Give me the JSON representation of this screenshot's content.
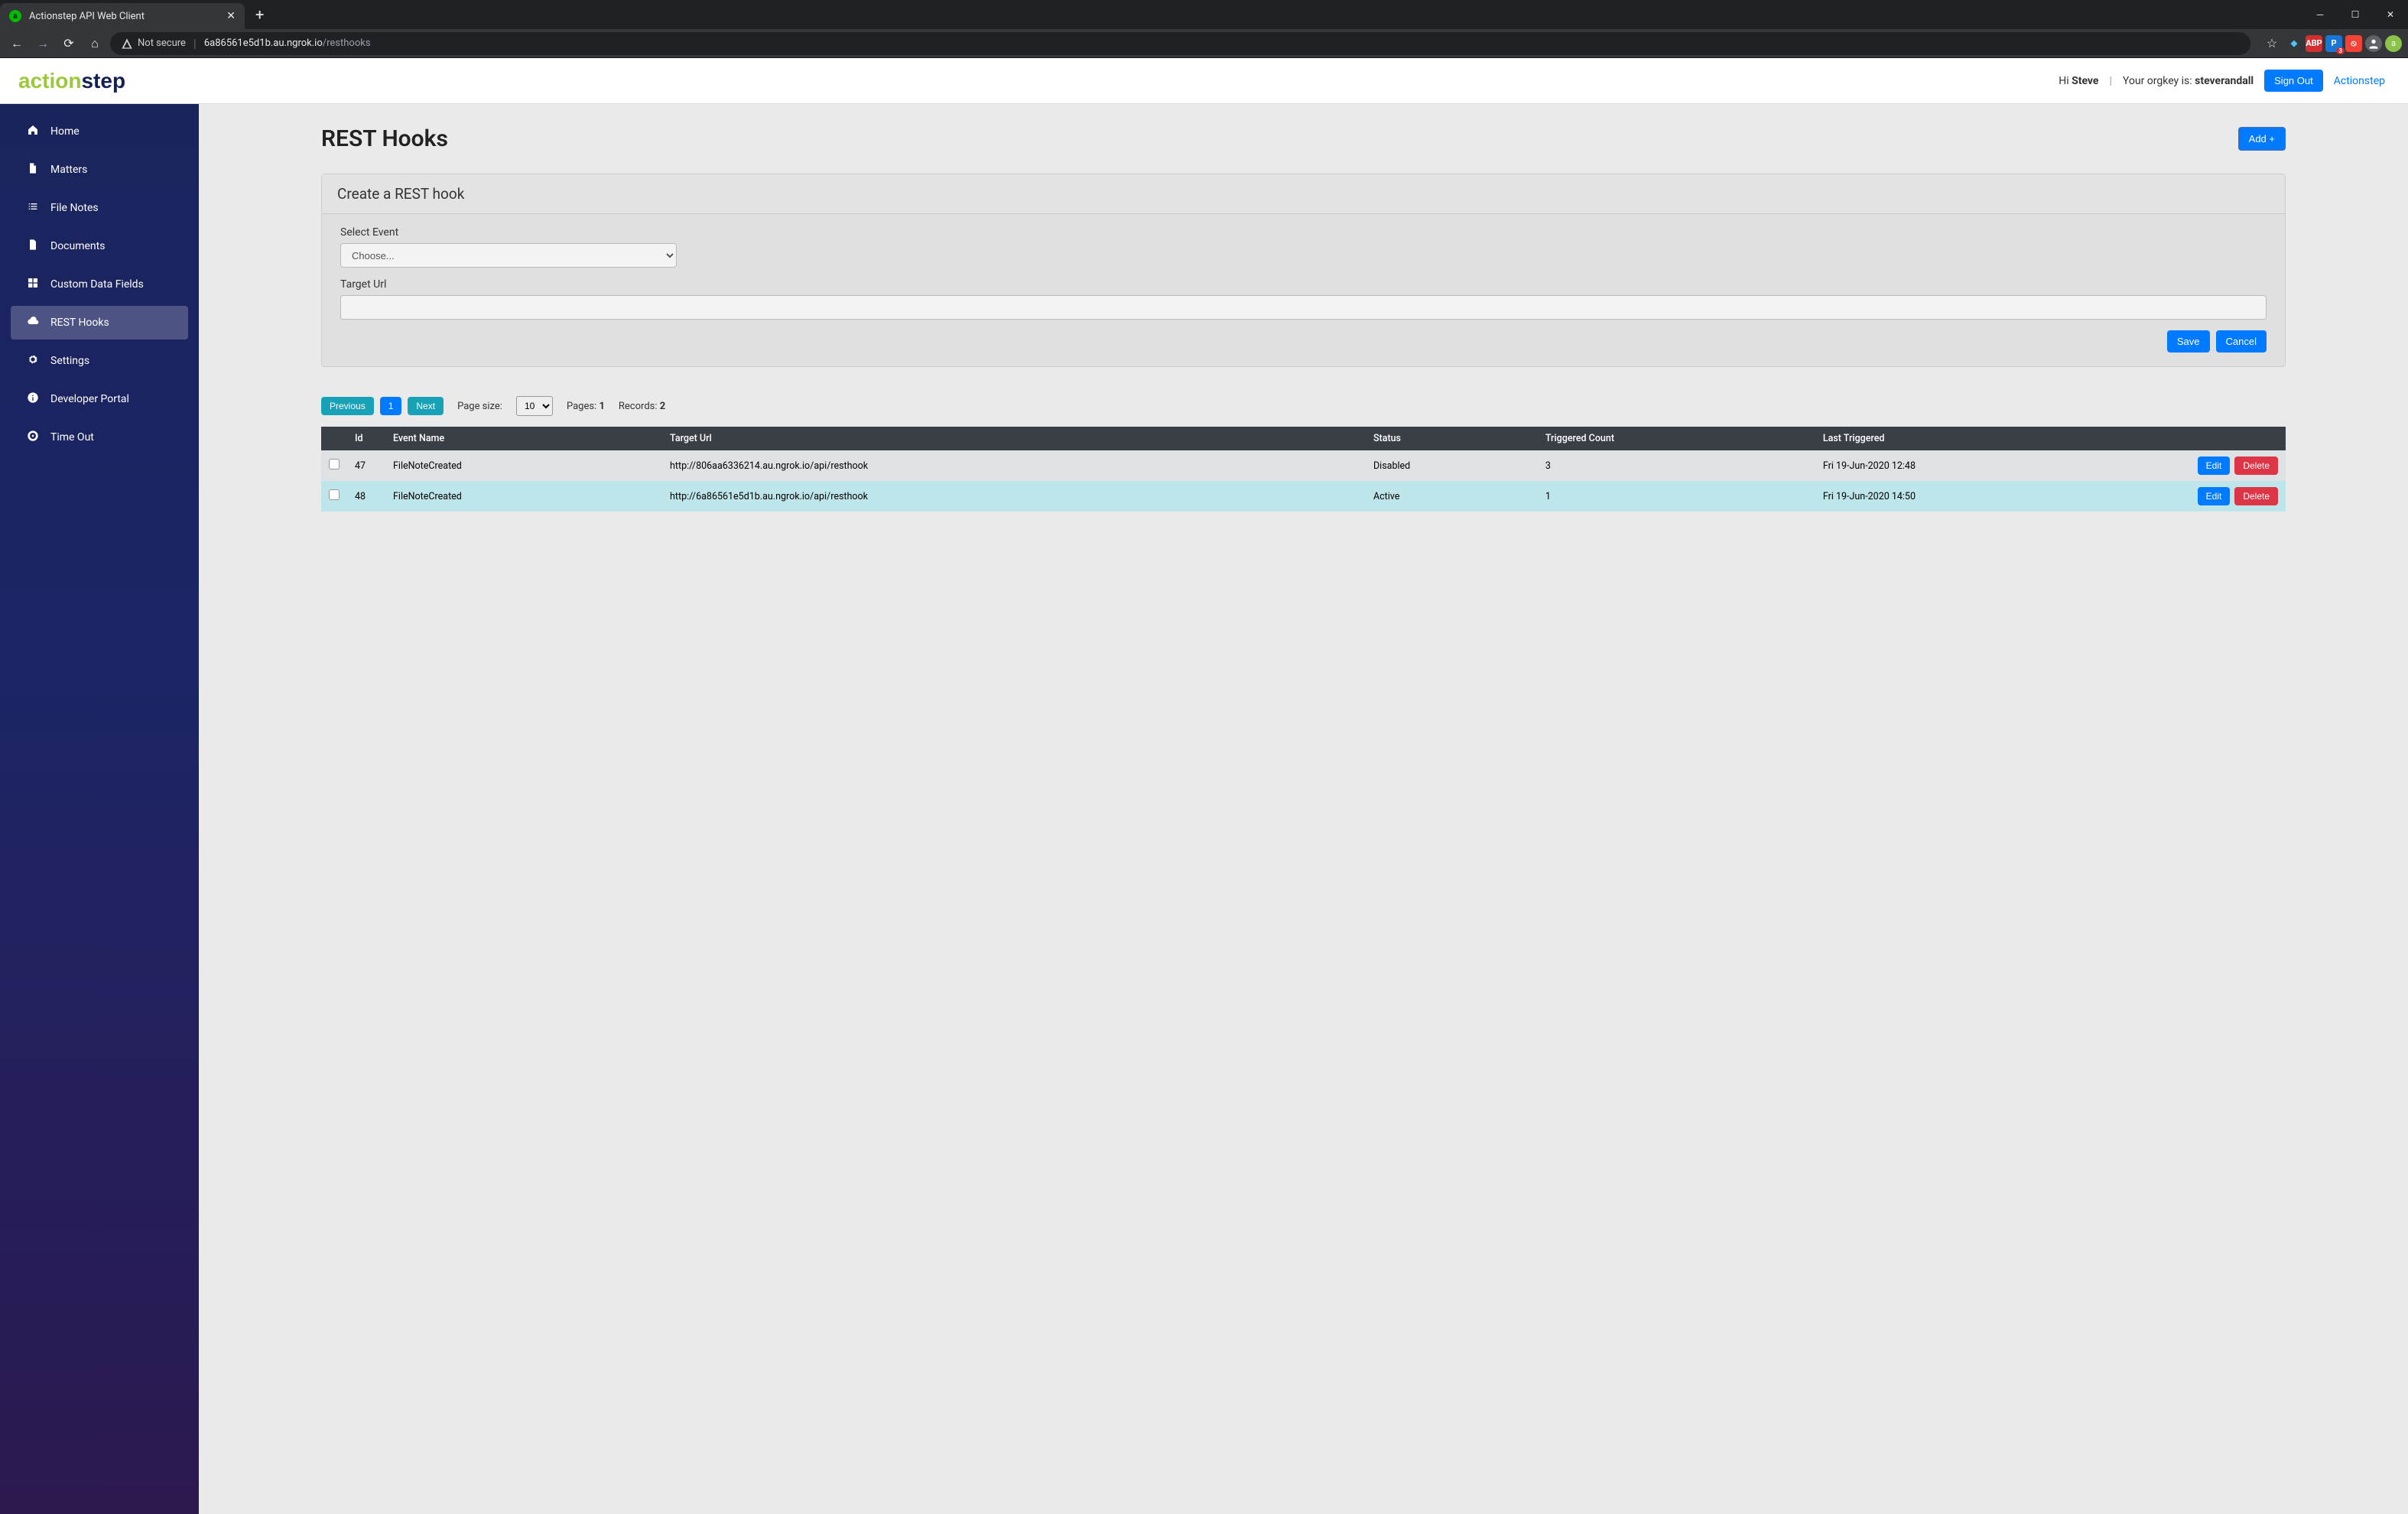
{
  "browser": {
    "tab_title": "Actionstep API Web Client",
    "not_secure_label": "Not secure",
    "url_host": "6a86561e5d1b.au.ngrok.io",
    "url_path": "/resthooks"
  },
  "header": {
    "logo_prefix": "action",
    "logo_suffix": "step",
    "greeting_prefix": "Hi ",
    "greeting_name": "Steve",
    "separator": "|",
    "orgkey_label": "Your orgkey is: ",
    "orgkey_value": "steverandall",
    "signout_label": "Sign Out",
    "brand_link": "Actionstep"
  },
  "sidebar": {
    "items": [
      {
        "label": "Home",
        "icon": "home-icon"
      },
      {
        "label": "Matters",
        "icon": "file-icon"
      },
      {
        "label": "File Notes",
        "icon": "list-icon"
      },
      {
        "label": "Documents",
        "icon": "doc-icon"
      },
      {
        "label": "Custom Data Fields",
        "icon": "grid-icon"
      },
      {
        "label": "REST Hooks",
        "icon": "cloud-icon",
        "active": true
      },
      {
        "label": "Settings",
        "icon": "gear-icon"
      },
      {
        "label": "Developer Portal",
        "icon": "info-icon"
      },
      {
        "label": "Time Out",
        "icon": "target-icon"
      }
    ]
  },
  "page": {
    "title": "REST Hooks",
    "add_label": "Add +"
  },
  "form": {
    "card_title": "Create a REST hook",
    "select_event_label": "Select Event",
    "select_event_value": "Choose...",
    "target_url_label": "Target Url",
    "target_url_value": "",
    "save_label": "Save",
    "cancel_label": "Cancel"
  },
  "pager": {
    "previous_label": "Previous",
    "page_current": "1",
    "next_label": "Next",
    "page_size_label": "Page size:",
    "page_size_value": "10",
    "pages_label": "Pages: ",
    "pages_value": "1",
    "records_label": "Records: ",
    "records_value": "2"
  },
  "table": {
    "columns": [
      "",
      "Id",
      "Event Name",
      "Target Url",
      "Status",
      "Triggered Count",
      "Last Triggered",
      ""
    ],
    "rows": [
      {
        "id": "47",
        "event_name": "FileNoteCreated",
        "target_url": "http://806aa6336214.au.ngrok.io/api/resthook",
        "status": "Disabled",
        "triggered_count": "3",
        "last_triggered": "Fri 19-Jun-2020 12:48",
        "row_class": "row-disabled"
      },
      {
        "id": "48",
        "event_name": "FileNoteCreated",
        "target_url": "http://6a86561e5d1b.au.ngrok.io/api/resthook",
        "status": "Active",
        "triggered_count": "1",
        "last_triggered": "Fri 19-Jun-2020 14:50",
        "row_class": "row-active"
      }
    ],
    "edit_label": "Edit",
    "delete_label": "Delete"
  }
}
